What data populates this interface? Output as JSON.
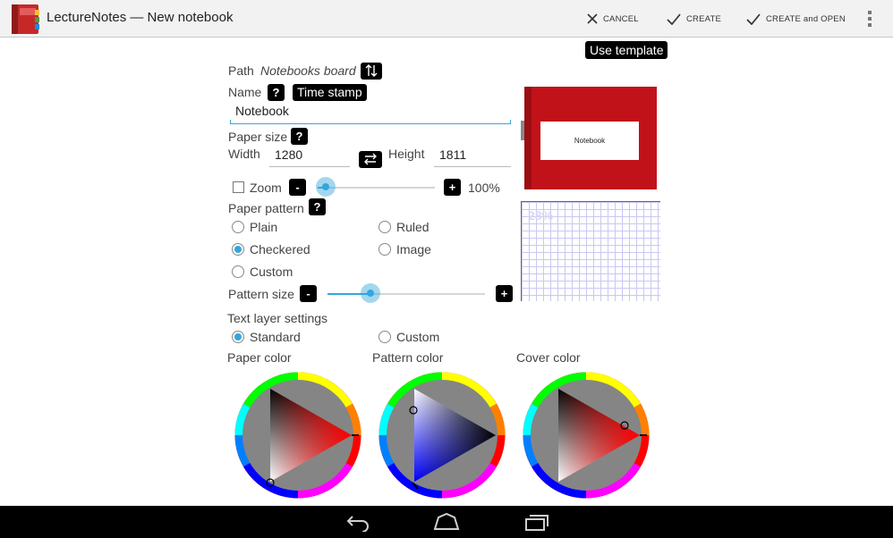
{
  "app": {
    "title": "LectureNotes — New notebook",
    "icon": "notebook-app-icon"
  },
  "actions": {
    "cancel": "CANCEL",
    "create": "CREATE",
    "create_open": "CREATE and OPEN"
  },
  "tooltip": "Use template",
  "path": {
    "label": "Path",
    "value": "Notebooks board"
  },
  "name": {
    "label": "Name",
    "help": "?",
    "timestamp": "Time stamp",
    "value": "Notebook"
  },
  "paper_size": {
    "label": "Paper size",
    "help": "?",
    "width_label": "Width",
    "width": "1280",
    "height_label": "Height",
    "height": "1811"
  },
  "zoom": {
    "label": "Zoom",
    "checked": false,
    "minus": "-",
    "plus": "+",
    "value_text": "100%",
    "level": 0.06
  },
  "paper_pattern": {
    "label": "Paper pattern",
    "help": "?",
    "options": [
      "Plain",
      "Ruled",
      "Checkered",
      "Image",
      "Custom"
    ],
    "selected": "Checkered"
  },
  "pattern_size": {
    "label": "Pattern size",
    "minus": "-",
    "plus": "+",
    "level": 0.27
  },
  "text_layer": {
    "label": "Text layer settings",
    "options": [
      "Standard",
      "Custom"
    ],
    "selected": "Standard"
  },
  "colors": {
    "paper_label": "Paper color",
    "pattern_label": "Pattern color",
    "cover_label": "Cover color",
    "paper_hex": "#ffffff",
    "pattern_hex": "#0000ff",
    "cover_hex": "#c1121a",
    "accent": "#33a7dc"
  },
  "preview": {
    "cover_text": "Notebook",
    "grid_scale": "28%"
  }
}
